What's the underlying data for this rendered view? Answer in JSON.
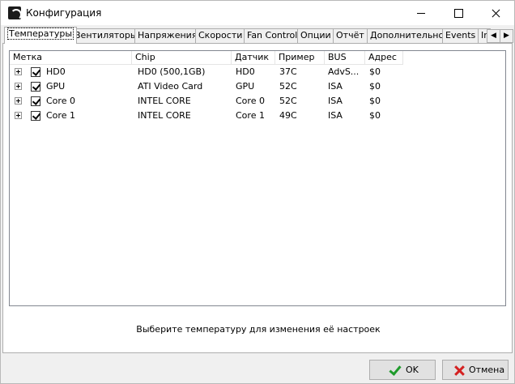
{
  "window": {
    "title": "Конфигурация"
  },
  "tabs": [
    {
      "label": "Температуры",
      "active": true
    },
    {
      "label": "Вентиляторы"
    },
    {
      "label": "Напряжения"
    },
    {
      "label": "Скорости"
    },
    {
      "label": "Fan Control"
    },
    {
      "label": "Опции"
    },
    {
      "label": "Отчёт"
    },
    {
      "label": "Дополнительно"
    },
    {
      "label": "Events"
    },
    {
      "label": "In"
    }
  ],
  "columns": [
    "Метка",
    "Chip",
    "Датчик",
    "Пример",
    "BUS",
    "Адрес"
  ],
  "rows": [
    {
      "label": "HD0",
      "chip": "HD0 (500,1GB)",
      "sensor": "HD0",
      "sample": "37C",
      "bus": "AdvS...",
      "address": "$0",
      "checked": true
    },
    {
      "label": "GPU",
      "chip": "ATI Video Card",
      "sensor": "GPU",
      "sample": "52C",
      "bus": "ISA",
      "address": "$0",
      "checked": true
    },
    {
      "label": "Core 0",
      "chip": "INTEL CORE",
      "sensor": "Core 0",
      "sample": "52C",
      "bus": "ISA",
      "address": "$0",
      "checked": true
    },
    {
      "label": "Core 1",
      "chip": "INTEL CORE",
      "sensor": "Core 1",
      "sample": "49C",
      "bus": "ISA",
      "address": "$0",
      "checked": true
    }
  ],
  "hint": "Выберите температуру для изменения её настроек",
  "buttons": {
    "ok": "OK",
    "cancel": "Отмена"
  },
  "icons": {
    "app": "fan-icon",
    "ok": "checkmark-icon",
    "cancel": "x-icon",
    "ok_color": "#1e9b2b",
    "cancel_color": "#d42121"
  }
}
